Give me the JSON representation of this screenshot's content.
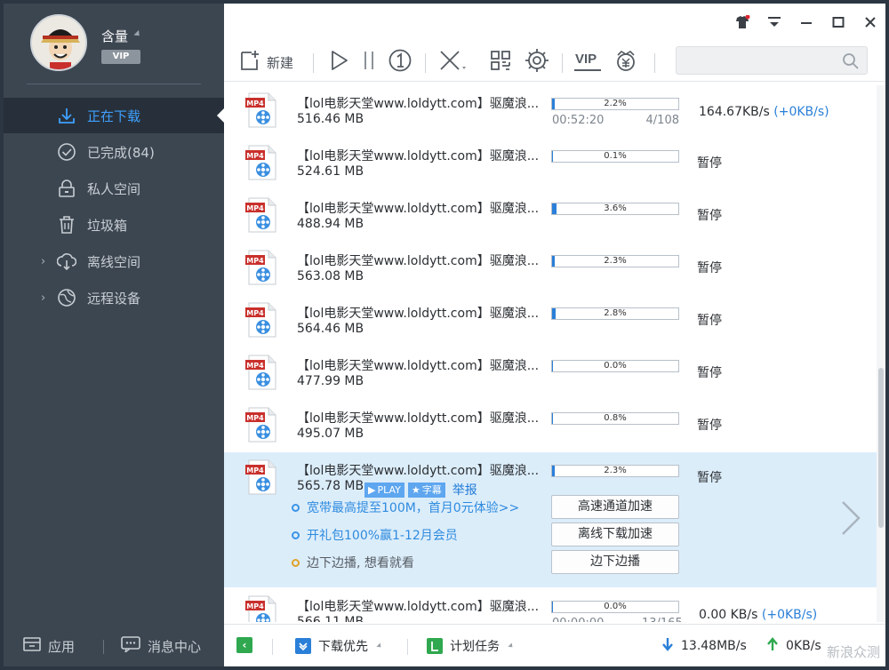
{
  "user": {
    "name": "含量",
    "vip_label": "VIP"
  },
  "sidebar": {
    "items": [
      {
        "label": "正在下载",
        "icon": "download-arrow-icon",
        "active": true,
        "expandable": false
      },
      {
        "label": "已完成(84)",
        "icon": "check-circle-icon",
        "active": false,
        "expandable": false
      },
      {
        "label": "私人空间",
        "icon": "lock-icon",
        "active": false,
        "expandable": false
      },
      {
        "label": "垃圾箱",
        "icon": "trash-icon",
        "active": false,
        "expandable": false
      },
      {
        "label": "离线空间",
        "icon": "cloud-download-icon",
        "active": false,
        "expandable": true
      },
      {
        "label": "远程设备",
        "icon": "globe-icon",
        "active": false,
        "expandable": true
      }
    ],
    "bottom": {
      "apps_label": "应用",
      "messages_label": "消息中心"
    }
  },
  "toolbar": {
    "new_label": "新建",
    "icons": [
      "new-task-icon",
      "play-icon",
      "pause-icon",
      "limit-one-icon",
      "delete-icon",
      "grid-icon",
      "settings-icon",
      "vip-icon",
      "wallet-icon"
    ],
    "vip_text": "VIP",
    "search_placeholder": ""
  },
  "downloads": [
    {
      "name": "【lol电影天堂www.loldytt.com】驱魔浪...",
      "size": "516.46 MB",
      "progress": 2.2,
      "progress_label": "2.2%",
      "eta": "00:52:20",
      "pieces": "4/108",
      "speed": "164.67KB/s",
      "speed_up": "(+0KB/s)"
    },
    {
      "name": "【lol电影天堂www.loldytt.com】驱魔浪...",
      "size": "524.61 MB",
      "progress": 0.1,
      "progress_label": "0.1%",
      "status": "暂停"
    },
    {
      "name": "【lol电影天堂www.loldytt.com】驱魔浪...",
      "size": "488.94 MB",
      "progress": 3.6,
      "progress_label": "3.6%",
      "status": "暂停"
    },
    {
      "name": "【lol电影天堂www.loldytt.com】驱魔浪...",
      "size": "563.08 MB",
      "progress": 2.3,
      "progress_label": "2.3%",
      "status": "暂停"
    },
    {
      "name": "【lol电影天堂www.loldytt.com】驱魔浪...",
      "size": "564.46 MB",
      "progress": 2.8,
      "progress_label": "2.8%",
      "status": "暂停"
    },
    {
      "name": "【lol电影天堂www.loldytt.com】驱魔浪...",
      "size": "477.99 MB",
      "progress": 0.0,
      "progress_label": "0.0%",
      "status": "暂停"
    },
    {
      "name": "【lol电影天堂www.loldytt.com】驱魔浪...",
      "size": "495.07 MB",
      "progress": 0.8,
      "progress_label": "0.8%",
      "status": "暂停"
    },
    {
      "name": "【lol电影天堂www.loldytt.com】驱魔浪...",
      "size": "565.78 MB",
      "progress": 2.3,
      "progress_label": "2.3%",
      "status": "暂停"
    },
    {
      "name": "【lol电影天堂www.loldytt.com】驱魔浪...",
      "size": "566.11 MB",
      "progress": 0.0,
      "progress_label": "0.0%",
      "eta": "00:00:00",
      "pieces": "13/165",
      "speed": "0.00  KB/s",
      "speed_up": "(+0KB/s)"
    }
  ],
  "expanded": {
    "play_tag": "PLAY",
    "subtitle_tag": "字幕",
    "report_link": "举报",
    "promos": [
      {
        "text": "宽带最高提至100M，首月0元体验>>",
        "style": "blue"
      },
      {
        "text": "开礼包100%赢1-12月会员",
        "style": "blue"
      },
      {
        "text": "边下边播, 想看就看",
        "style": "gray"
      }
    ],
    "buttons": [
      "高速通道加速",
      "离线下载加速",
      "边下边播"
    ]
  },
  "statusbar": {
    "priority_label": "下载优先",
    "schedule_label": "计划任务",
    "down_speed": "13.48MB/s",
    "up_speed": "0KB/s"
  },
  "watermark": "新浪众测",
  "colors": {
    "sidebar": "#3c4651",
    "accent": "#2a7fd8",
    "expanded_row": "#dcedfa"
  }
}
